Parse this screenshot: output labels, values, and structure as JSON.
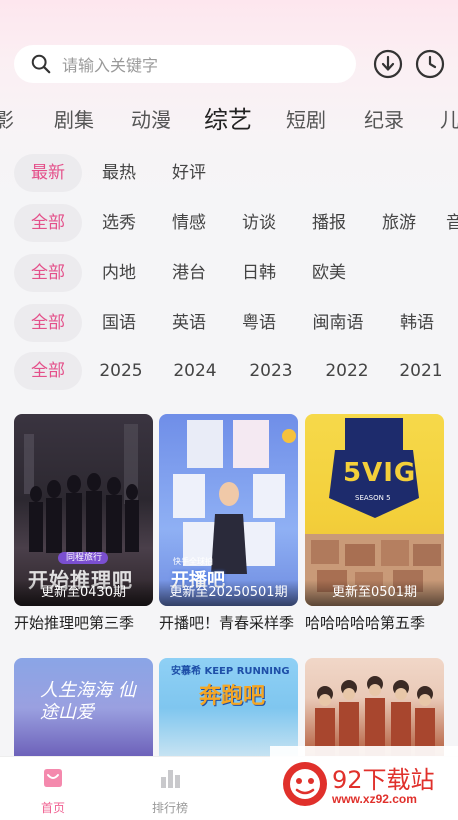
{
  "search": {
    "placeholder": "请输入关键字"
  },
  "categories": [
    "影",
    "剧集",
    "动漫",
    "综艺",
    "短剧",
    "纪录",
    "儿"
  ],
  "filters": {
    "sort": [
      "最新",
      "最热",
      "好评"
    ],
    "genre": [
      "全部",
      "选秀",
      "情感",
      "访谈",
      "播报",
      "旅游",
      "音"
    ],
    "region": [
      "全部",
      "内地",
      "港台",
      "日韩",
      "欧美"
    ],
    "language": [
      "全部",
      "国语",
      "英语",
      "粤语",
      "闽南语",
      "韩语"
    ],
    "year": [
      "全部",
      "2025",
      "2024",
      "2023",
      "2022",
      "2021"
    ]
  },
  "cards": [
    {
      "badge": "更新至0430期",
      "title": "开始推理吧第三季",
      "logo_text": "开始推理吧",
      "sponsor": "同程旅行"
    },
    {
      "badge": "更新至20250501期",
      "title": "开播吧！青春采样季",
      "logo_text": "开播吧",
      "sponsor": "快手全球拍"
    },
    {
      "badge": "更新至0501期",
      "title": "哈哈哈哈哈第五季",
      "logo_text": "5VIG",
      "sponsor": "SEASON 5"
    }
  ],
  "cards_row2": [
    {
      "art_text": "人生海海 仙途山爱"
    },
    {
      "art_text": "奔跑吧",
      "sponsor": "安慕希 KEEP RUNNING"
    },
    {
      "art_text": ""
    }
  ],
  "tabbar": {
    "home": "首页",
    "rank": "排行榜"
  },
  "watermark": {
    "title": "92下载站",
    "url": "www.xz92.com"
  },
  "colors": {
    "accent": "#e4508a",
    "chip_bg": "#ecebee",
    "tab_active": "#f06292"
  }
}
